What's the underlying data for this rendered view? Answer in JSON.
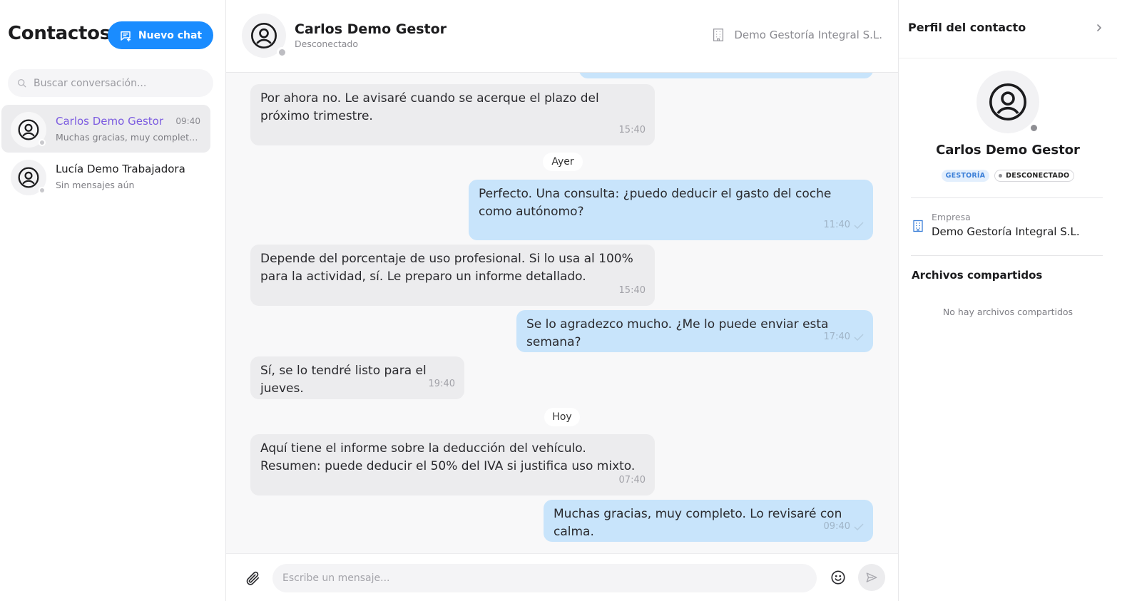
{
  "sidebar": {
    "title": "Contactos",
    "new_chat_label": "Nuevo chat",
    "search_placeholder": "Buscar conversación...",
    "contacts": [
      {
        "name": "Carlos Demo Gestor",
        "time": "09:40",
        "preview": "Muchas gracias, muy completo...",
        "active": true
      },
      {
        "name": "Lucía Demo Trabajadora",
        "time": "",
        "preview": "Sin mensajes aún",
        "active": false
      }
    ]
  },
  "chat": {
    "contact_name": "Carlos Demo Gestor",
    "contact_status": "Desconectado",
    "company": "Demo Gestoría Integral S.L.",
    "day_labels": {
      "yesterday": "Ayer",
      "today": "Hoy"
    },
    "messages": [
      {
        "direction": "in",
        "text": "Por ahora no. Le avisaré cuando se acerque el plazo del próximo trimestre.",
        "time": "15:40"
      },
      {
        "direction": "out",
        "text": "Perfecto. Una consulta: ¿puedo deducir el gasto del coche como autónomo?",
        "time": "11:40"
      },
      {
        "direction": "in",
        "text": "Depende del porcentaje de uso profesional. Si lo usa al 100% para la actividad, sí. Le preparo un informe detallado.",
        "time": "15:40"
      },
      {
        "direction": "out",
        "text": "Se lo agradezco mucho. ¿Me lo puede enviar esta semana?",
        "time": "17:40"
      },
      {
        "direction": "in",
        "text": "Sí, se lo tendré listo para el jueves.",
        "time": "19:40"
      },
      {
        "direction": "in",
        "text": "Aquí tiene el informe sobre la deducción del vehículo. Resumen: puede deducir el 50% del IVA si justifica uso mixto.",
        "time": "07:40"
      },
      {
        "direction": "out",
        "text": "Muchas gracias, muy completo. Lo revisaré con calma.",
        "time": "09:40"
      }
    ],
    "input_placeholder": "Escribe un mensaje..."
  },
  "profile": {
    "title": "Perfil del contacto",
    "name": "Carlos Demo Gestor",
    "role_badge": "GESTORÍA",
    "status_badge": "DESCONECTADO",
    "company_label": "Empresa",
    "company_value": "Demo Gestoría Integral S.L.",
    "files_title": "Archivos compartidos",
    "files_empty": "No hay archivos compartidos"
  },
  "colors": {
    "accent": "#1a8cff",
    "active_contact_name": "#7c5ce0",
    "outgoing_bubble": "#c8e4fb",
    "incoming_bubble": "#ececee",
    "offline_dot": "#8e8e93"
  },
  "icons": [
    "chat-plus-icon",
    "search-icon",
    "user-circle-icon",
    "building-icon",
    "chevron-right-icon",
    "check-icon",
    "paperclip-icon",
    "emoji-icon",
    "send-icon"
  ]
}
